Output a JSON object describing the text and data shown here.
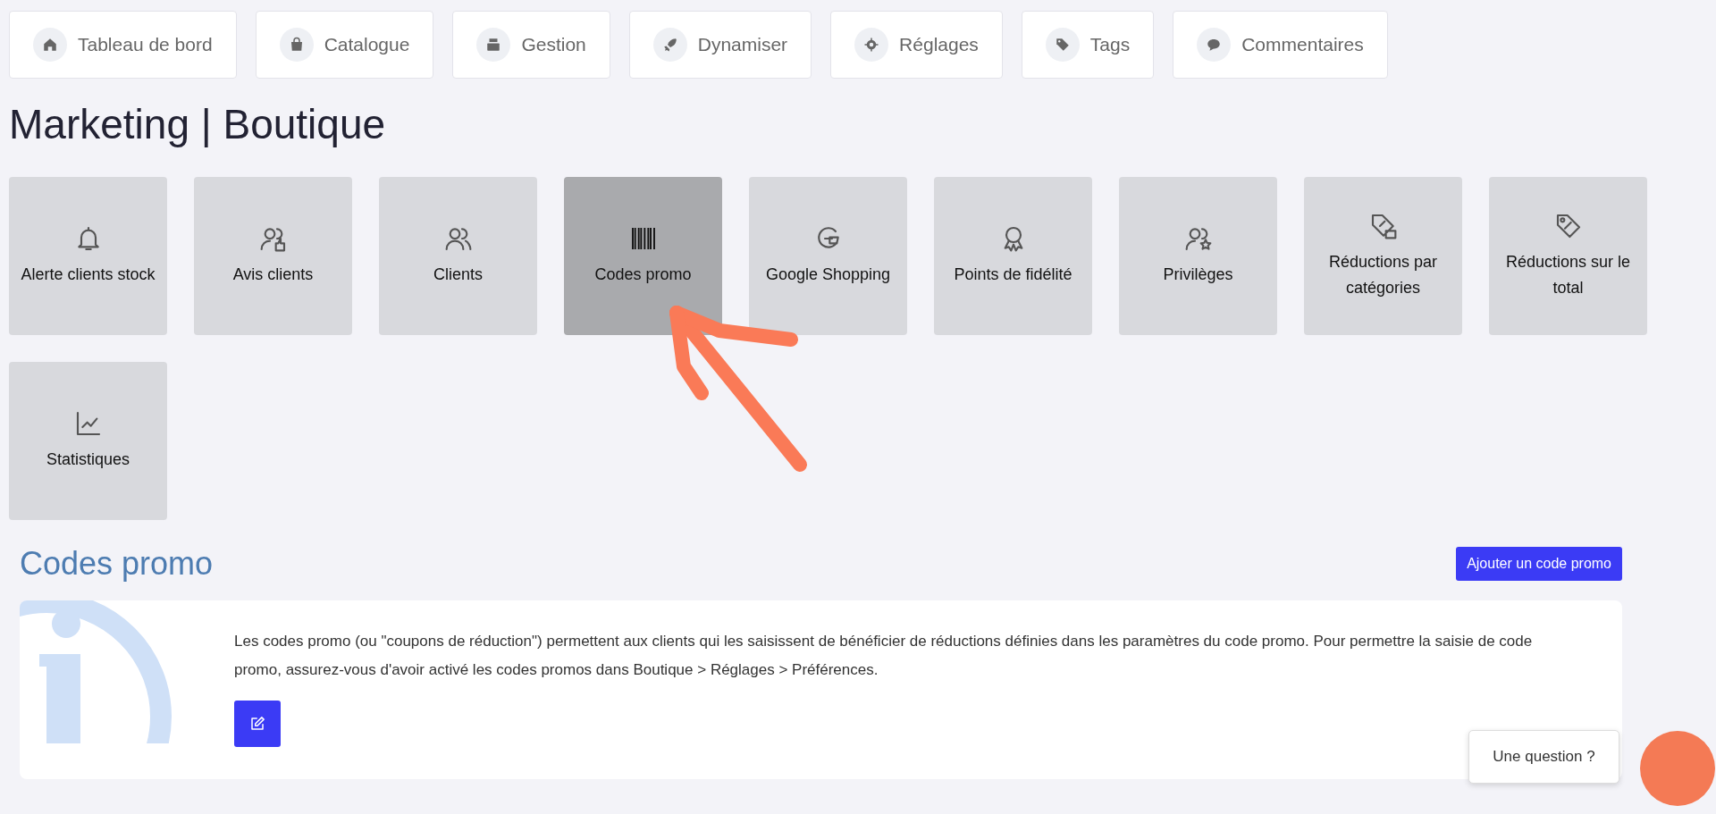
{
  "nav": [
    {
      "label": "Tableau de bord"
    },
    {
      "label": "Catalogue"
    },
    {
      "label": "Gestion"
    },
    {
      "label": "Dynamiser"
    },
    {
      "label": "Réglages"
    },
    {
      "label": "Tags"
    },
    {
      "label": "Commentaires"
    }
  ],
  "title": "Marketing | Boutique",
  "tiles": [
    {
      "label": "Alerte clients stock",
      "selected": false
    },
    {
      "label": "Avis clients",
      "selected": false
    },
    {
      "label": "Clients",
      "selected": false
    },
    {
      "label": "Codes promo",
      "selected": true
    },
    {
      "label": "Google Shopping",
      "selected": false
    },
    {
      "label": "Points de fidélité",
      "selected": false
    },
    {
      "label": "Privilèges",
      "selected": false
    },
    {
      "label": "Réductions par catégories",
      "selected": false
    },
    {
      "label": "Réductions sur le total",
      "selected": false
    },
    {
      "label": "Statistiques",
      "selected": false
    }
  ],
  "section": {
    "heading": "Codes promo",
    "add_button": "Ajouter un code promo",
    "info_text": "Les codes promo (ou \"coupons de réduction\") permettent aux clients qui les saisissent de bénéficier de réductions définies dans les paramètres du code promo. Pour permettre la saisie de code promo, assurez-vous d'avoir activé les codes promos dans Boutique > Réglages > Préférences."
  },
  "help_button": "Une question ?"
}
